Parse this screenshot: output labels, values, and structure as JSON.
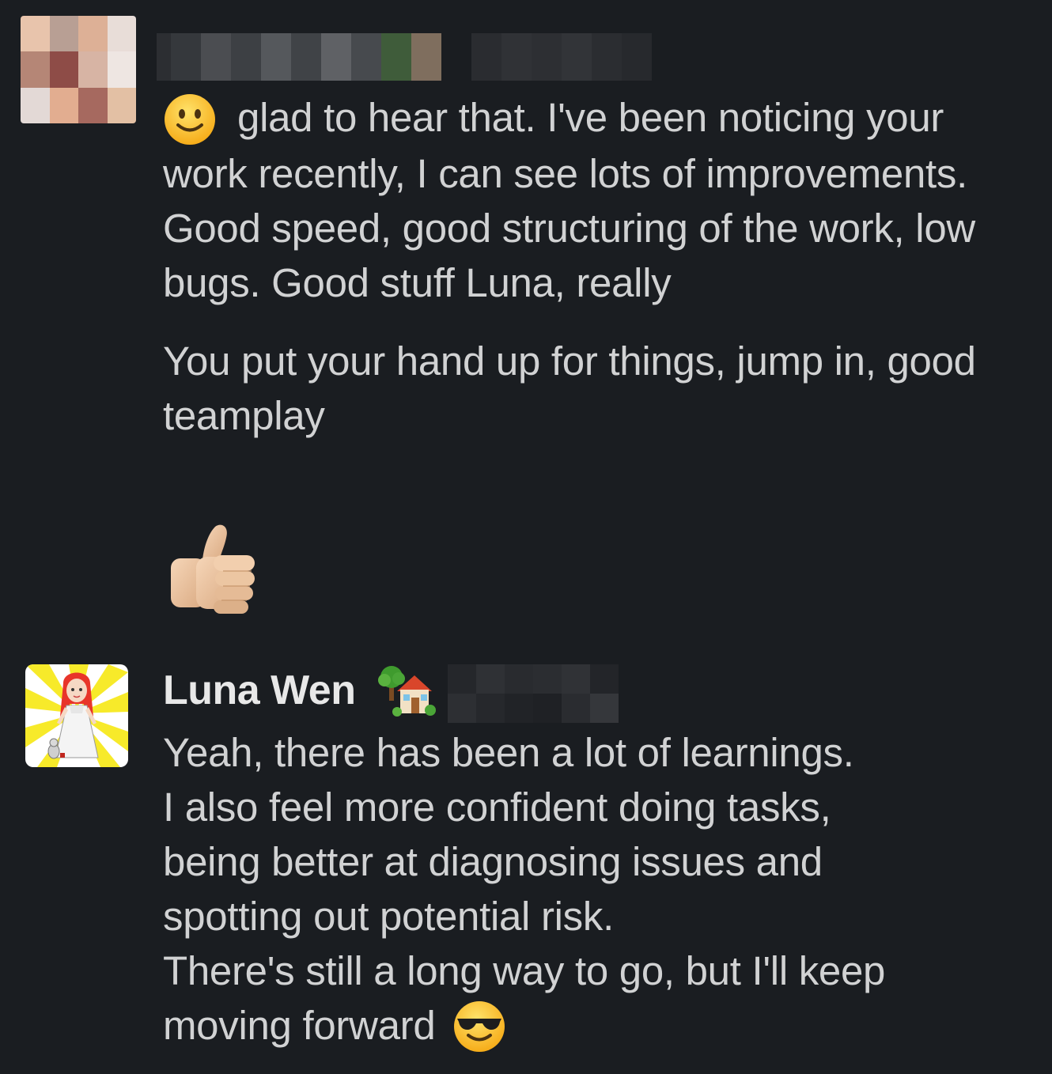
{
  "messages": [
    {
      "author": "",
      "paragraphs": [
        "glad to hear that. I've been noticing your work recently, I can see lots of improvements. Good speed, good structuring of the work, low bugs. Good stuff Luna, really",
        "You put your hand up for things, jump in, good teamplay"
      ],
      "leading_emoji": "slightly-smiling-face",
      "trailing_emoji": "thumbs-up-light-skin"
    },
    {
      "author": "Luna Wen",
      "status_emoji": "house-with-garden",
      "lines": [
        "Yeah, there has been a lot of learnings.",
        "I also feel more confident doing tasks,",
        "being better at diagnosing issues and",
        "spotting out potential risk.",
        "There's still a long way to go, but I'll keep",
        "moving forward"
      ],
      "trailing_emoji": "smiling-face-with-sunglasses"
    }
  ],
  "colors": {
    "background": "#1a1d21",
    "text": "#d1d2d3",
    "author": "#e8e8e8"
  }
}
